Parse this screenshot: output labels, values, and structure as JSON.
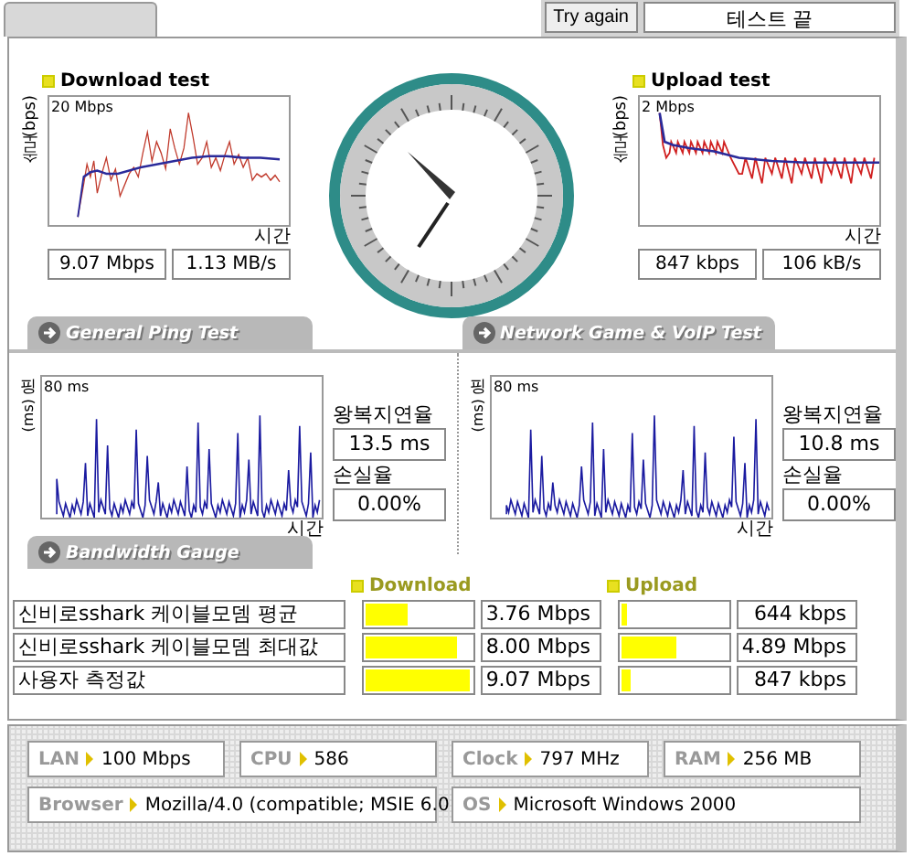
{
  "header": {
    "try_again_button": "Try again",
    "status": "테스트 끝"
  },
  "download_test": {
    "title": "Download test",
    "y_axis_label": "속도 (bps)",
    "y_max_label": "20 Mbps",
    "x_axis_label": "시간",
    "speed": "9.07 Mbps",
    "rate": "1.13 MB/s"
  },
  "upload_test": {
    "title": "Upload test",
    "y_axis_label": "속도 (bps)",
    "y_max_label": "2 Mbps",
    "x_axis_label": "시간",
    "speed": "847 kbps",
    "rate": "106 kB/s"
  },
  "ping_tests": [
    {
      "title": "General Ping Test",
      "y_axis_char": "핑",
      "y_axis_unit": "(ms)",
      "y_max_label": "80 ms",
      "x_axis_label": "시간",
      "latency_label": "왕복지연율",
      "latency": "13.5 ms",
      "loss_label": "손실율",
      "loss": "0.00%"
    },
    {
      "title": "Network Game & VoIP Test",
      "y_axis_char": "핑",
      "y_axis_unit": "(ms)",
      "y_max_label": "80 ms",
      "x_axis_label": "시간",
      "latency_label": "왕복지연율",
      "latency": "10.8 ms",
      "loss_label": "손실율",
      "loss": "0.00%"
    }
  ],
  "bandwidth_gauge": {
    "title": "Bandwidth Gauge",
    "download_header": "Download",
    "upload_header": "Upload",
    "rows": [
      {
        "label": "신비로sshark 케이블모뎀 평균",
        "download": {
          "level": 0.4,
          "reading": "3.76 Mbps"
        },
        "upload": {
          "level": 0.05,
          "reading": "644 kbps"
        }
      },
      {
        "label": "신비로sshark 케이블모뎀 최대값",
        "download": {
          "level": 0.87,
          "reading": "8.00 Mbps"
        },
        "upload": {
          "level": 0.51,
          "reading": "4.89 Mbps"
        }
      },
      {
        "label": "사용자 측정값",
        "download": {
          "level": 0.98,
          "reading": "9.07 Mbps"
        },
        "upload": {
          "level": 0.09,
          "reading": "847 kbps"
        }
      }
    ]
  },
  "system_info": {
    "rows": [
      {
        "items": [
          {
            "label": "LAN",
            "value": "100 Mbps"
          },
          {
            "label": "CPU",
            "value": "586"
          },
          {
            "label": "Clock",
            "value": "797 MHz"
          },
          {
            "label": "RAM",
            "value": "256 MB"
          }
        ]
      },
      {
        "items": [
          {
            "label": "Browser",
            "value": "Mozilla/4.0 (compatible; MSIE 6.0"
          },
          {
            "label": "OS",
            "value": "Microsoft Windows 2000"
          }
        ]
      }
    ]
  }
}
